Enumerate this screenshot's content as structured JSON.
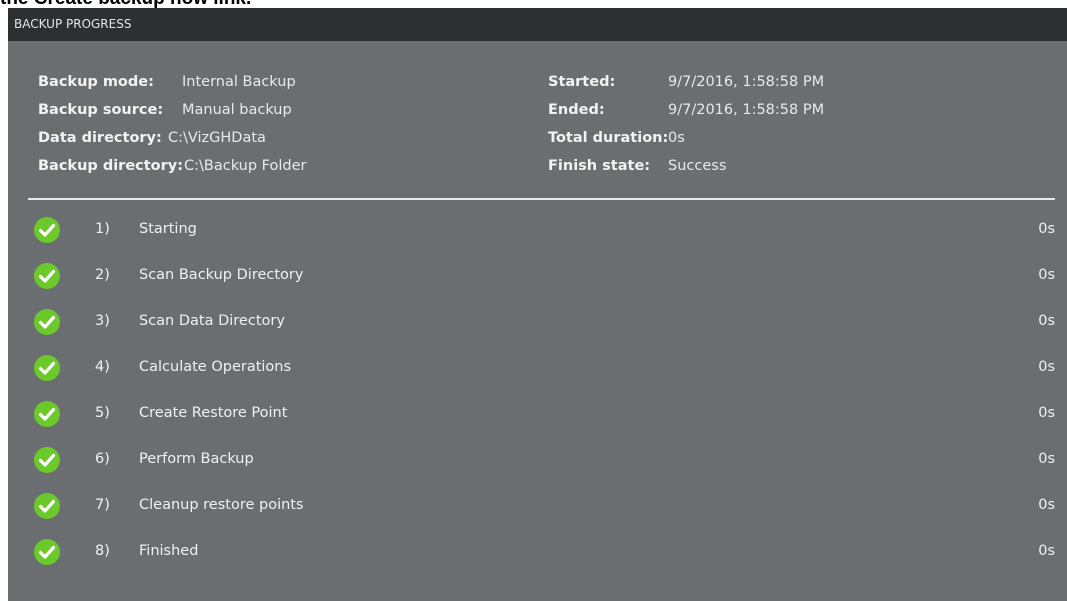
{
  "top_caption": "the Create backup now link.",
  "window": {
    "title": "BACKUP PROGRESS"
  },
  "info": {
    "left": [
      {
        "label": "Backup mode:",
        "value": "Internal Backup"
      },
      {
        "label": "Backup source:",
        "value": "Manual backup"
      },
      {
        "label": "Data directory:",
        "value": "C:\\VizGHData"
      },
      {
        "label": "Backup directory:",
        "value": "C:\\Backup Folder"
      }
    ],
    "right": [
      {
        "label": "Started:",
        "value": "9/7/2016, 1:58:58 PM"
      },
      {
        "label": "Ended:",
        "value": "9/7/2016, 1:58:58 PM"
      },
      {
        "label": "Total duration:",
        "value": "0s"
      },
      {
        "label": "Finish state:",
        "value": "Success"
      }
    ]
  },
  "steps": [
    {
      "num": "1)",
      "label": "Starting",
      "duration": "0s",
      "status_icon": "check-circle-icon"
    },
    {
      "num": "2)",
      "label": "Scan Backup Directory",
      "duration": "0s",
      "status_icon": "check-circle-icon"
    },
    {
      "num": "3)",
      "label": "Scan Data Directory",
      "duration": "0s",
      "status_icon": "check-circle-icon"
    },
    {
      "num": "4)",
      "label": "Calculate Operations",
      "duration": "0s",
      "status_icon": "check-circle-icon"
    },
    {
      "num": "5)",
      "label": "Create Restore Point",
      "duration": "0s",
      "status_icon": "check-circle-icon"
    },
    {
      "num": "6)",
      "label": "Perform Backup",
      "duration": "0s",
      "status_icon": "check-circle-icon"
    },
    {
      "num": "7)",
      "label": "Cleanup restore points",
      "duration": "0s",
      "status_icon": "check-circle-icon"
    },
    {
      "num": "8)",
      "label": "Finished",
      "duration": "0s",
      "status_icon": "check-circle-icon"
    }
  ],
  "colors": {
    "panel_bg": "#6b6e70",
    "titlebar_bg": "#2e2f30",
    "success_green": "#6cc92a"
  }
}
